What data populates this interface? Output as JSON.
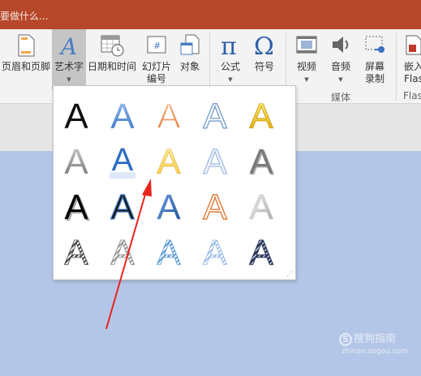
{
  "titlebar": {
    "tell_me": "要做什么...",
    "color": "#b7472a"
  },
  "ribbon": {
    "buttons": [
      {
        "id": "header-footer",
        "label": "页眉和页脚",
        "icon": "header-footer-icon"
      },
      {
        "id": "wordart",
        "label": "艺术字",
        "icon": "wordart-icon",
        "dropdown": true,
        "active": true
      },
      {
        "id": "datetime",
        "label": "日期和时间",
        "icon": "calendar-clock-icon"
      },
      {
        "id": "slide-number",
        "label_line1": "幻灯片",
        "label_line2": "编号",
        "icon": "slide-number-icon"
      },
      {
        "id": "object",
        "label": "对象",
        "icon": "object-icon"
      },
      {
        "id": "equation",
        "label": "公式",
        "icon": "pi-icon",
        "dropdown": true
      },
      {
        "id": "symbol",
        "label": "符号",
        "icon": "omega-icon"
      },
      {
        "id": "video",
        "label": "视频",
        "icon": "film-icon",
        "dropdown": true
      },
      {
        "id": "audio",
        "label": "音频",
        "icon": "speaker-icon",
        "dropdown": true
      },
      {
        "id": "screen-record",
        "label_line1": "屏幕",
        "label_line2": "录制",
        "icon": "screen-record-icon"
      },
      {
        "id": "embed-flash",
        "label_line1": "嵌入",
        "label_line2": "Flas",
        "icon": "flash-icon"
      }
    ],
    "groups": {
      "media": "媒体",
      "flash": "Flas"
    }
  },
  "gallery": {
    "glyph": "A",
    "styles": [
      [
        "plain-black",
        "blue-gradient",
        "orange-outline",
        "white-outline-blue",
        "gold-gradient"
      ],
      [
        "gray-gradient",
        "blue-reflection",
        "yellow-gradient",
        "light-blue-outline",
        "gray-3d"
      ],
      [
        "black-shadow",
        "black-blue-outline",
        "blue-bevel",
        "orange-white-outline",
        "silver-gray"
      ],
      [
        "striped-black",
        "striped-gray",
        "striped-blue",
        "striped-light",
        "dark-navy-hatched"
      ]
    ]
  },
  "watermark": {
    "brand": "搜狗指南",
    "url": "zhinan.sogou.com"
  }
}
